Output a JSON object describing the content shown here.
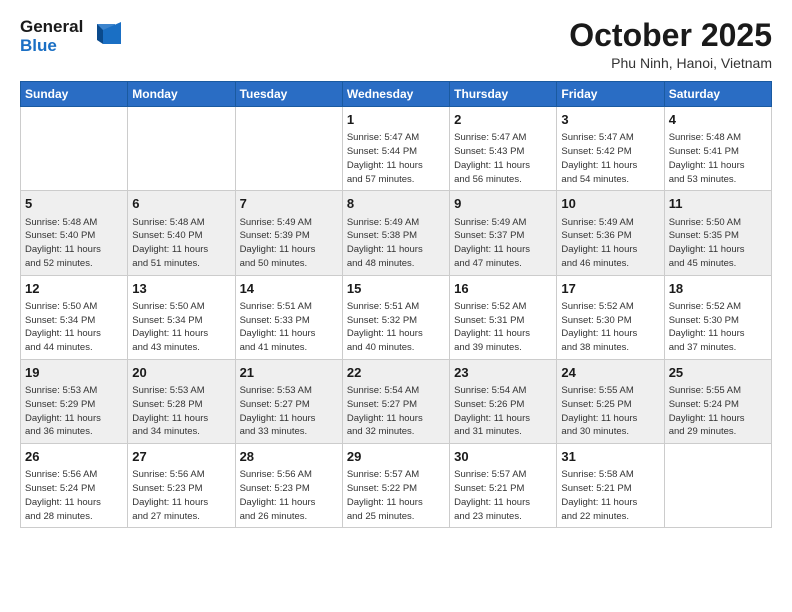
{
  "header": {
    "logo_text_general": "General",
    "logo_text_blue": "Blue",
    "month_title": "October 2025",
    "location": "Phu Ninh, Hanoi, Vietnam"
  },
  "days_of_week": [
    "Sunday",
    "Monday",
    "Tuesday",
    "Wednesday",
    "Thursday",
    "Friday",
    "Saturday"
  ],
  "weeks": [
    [
      {
        "day": "",
        "info": ""
      },
      {
        "day": "",
        "info": ""
      },
      {
        "day": "",
        "info": ""
      },
      {
        "day": "1",
        "info": "Sunrise: 5:47 AM\nSunset: 5:44 PM\nDaylight: 11 hours\nand 57 minutes."
      },
      {
        "day": "2",
        "info": "Sunrise: 5:47 AM\nSunset: 5:43 PM\nDaylight: 11 hours\nand 56 minutes."
      },
      {
        "day": "3",
        "info": "Sunrise: 5:47 AM\nSunset: 5:42 PM\nDaylight: 11 hours\nand 54 minutes."
      },
      {
        "day": "4",
        "info": "Sunrise: 5:48 AM\nSunset: 5:41 PM\nDaylight: 11 hours\nand 53 minutes."
      }
    ],
    [
      {
        "day": "5",
        "info": "Sunrise: 5:48 AM\nSunset: 5:40 PM\nDaylight: 11 hours\nand 52 minutes."
      },
      {
        "day": "6",
        "info": "Sunrise: 5:48 AM\nSunset: 5:40 PM\nDaylight: 11 hours\nand 51 minutes."
      },
      {
        "day": "7",
        "info": "Sunrise: 5:49 AM\nSunset: 5:39 PM\nDaylight: 11 hours\nand 50 minutes."
      },
      {
        "day": "8",
        "info": "Sunrise: 5:49 AM\nSunset: 5:38 PM\nDaylight: 11 hours\nand 48 minutes."
      },
      {
        "day": "9",
        "info": "Sunrise: 5:49 AM\nSunset: 5:37 PM\nDaylight: 11 hours\nand 47 minutes."
      },
      {
        "day": "10",
        "info": "Sunrise: 5:49 AM\nSunset: 5:36 PM\nDaylight: 11 hours\nand 46 minutes."
      },
      {
        "day": "11",
        "info": "Sunrise: 5:50 AM\nSunset: 5:35 PM\nDaylight: 11 hours\nand 45 minutes."
      }
    ],
    [
      {
        "day": "12",
        "info": "Sunrise: 5:50 AM\nSunset: 5:34 PM\nDaylight: 11 hours\nand 44 minutes."
      },
      {
        "day": "13",
        "info": "Sunrise: 5:50 AM\nSunset: 5:34 PM\nDaylight: 11 hours\nand 43 minutes."
      },
      {
        "day": "14",
        "info": "Sunrise: 5:51 AM\nSunset: 5:33 PM\nDaylight: 11 hours\nand 41 minutes."
      },
      {
        "day": "15",
        "info": "Sunrise: 5:51 AM\nSunset: 5:32 PM\nDaylight: 11 hours\nand 40 minutes."
      },
      {
        "day": "16",
        "info": "Sunrise: 5:52 AM\nSunset: 5:31 PM\nDaylight: 11 hours\nand 39 minutes."
      },
      {
        "day": "17",
        "info": "Sunrise: 5:52 AM\nSunset: 5:30 PM\nDaylight: 11 hours\nand 38 minutes."
      },
      {
        "day": "18",
        "info": "Sunrise: 5:52 AM\nSunset: 5:30 PM\nDaylight: 11 hours\nand 37 minutes."
      }
    ],
    [
      {
        "day": "19",
        "info": "Sunrise: 5:53 AM\nSunset: 5:29 PM\nDaylight: 11 hours\nand 36 minutes."
      },
      {
        "day": "20",
        "info": "Sunrise: 5:53 AM\nSunset: 5:28 PM\nDaylight: 11 hours\nand 34 minutes."
      },
      {
        "day": "21",
        "info": "Sunrise: 5:53 AM\nSunset: 5:27 PM\nDaylight: 11 hours\nand 33 minutes."
      },
      {
        "day": "22",
        "info": "Sunrise: 5:54 AM\nSunset: 5:27 PM\nDaylight: 11 hours\nand 32 minutes."
      },
      {
        "day": "23",
        "info": "Sunrise: 5:54 AM\nSunset: 5:26 PM\nDaylight: 11 hours\nand 31 minutes."
      },
      {
        "day": "24",
        "info": "Sunrise: 5:55 AM\nSunset: 5:25 PM\nDaylight: 11 hours\nand 30 minutes."
      },
      {
        "day": "25",
        "info": "Sunrise: 5:55 AM\nSunset: 5:24 PM\nDaylight: 11 hours\nand 29 minutes."
      }
    ],
    [
      {
        "day": "26",
        "info": "Sunrise: 5:56 AM\nSunset: 5:24 PM\nDaylight: 11 hours\nand 28 minutes."
      },
      {
        "day": "27",
        "info": "Sunrise: 5:56 AM\nSunset: 5:23 PM\nDaylight: 11 hours\nand 27 minutes."
      },
      {
        "day": "28",
        "info": "Sunrise: 5:56 AM\nSunset: 5:23 PM\nDaylight: 11 hours\nand 26 minutes."
      },
      {
        "day": "29",
        "info": "Sunrise: 5:57 AM\nSunset: 5:22 PM\nDaylight: 11 hours\nand 25 minutes."
      },
      {
        "day": "30",
        "info": "Sunrise: 5:57 AM\nSunset: 5:21 PM\nDaylight: 11 hours\nand 23 minutes."
      },
      {
        "day": "31",
        "info": "Sunrise: 5:58 AM\nSunset: 5:21 PM\nDaylight: 11 hours\nand 22 minutes."
      },
      {
        "day": "",
        "info": ""
      }
    ]
  ]
}
